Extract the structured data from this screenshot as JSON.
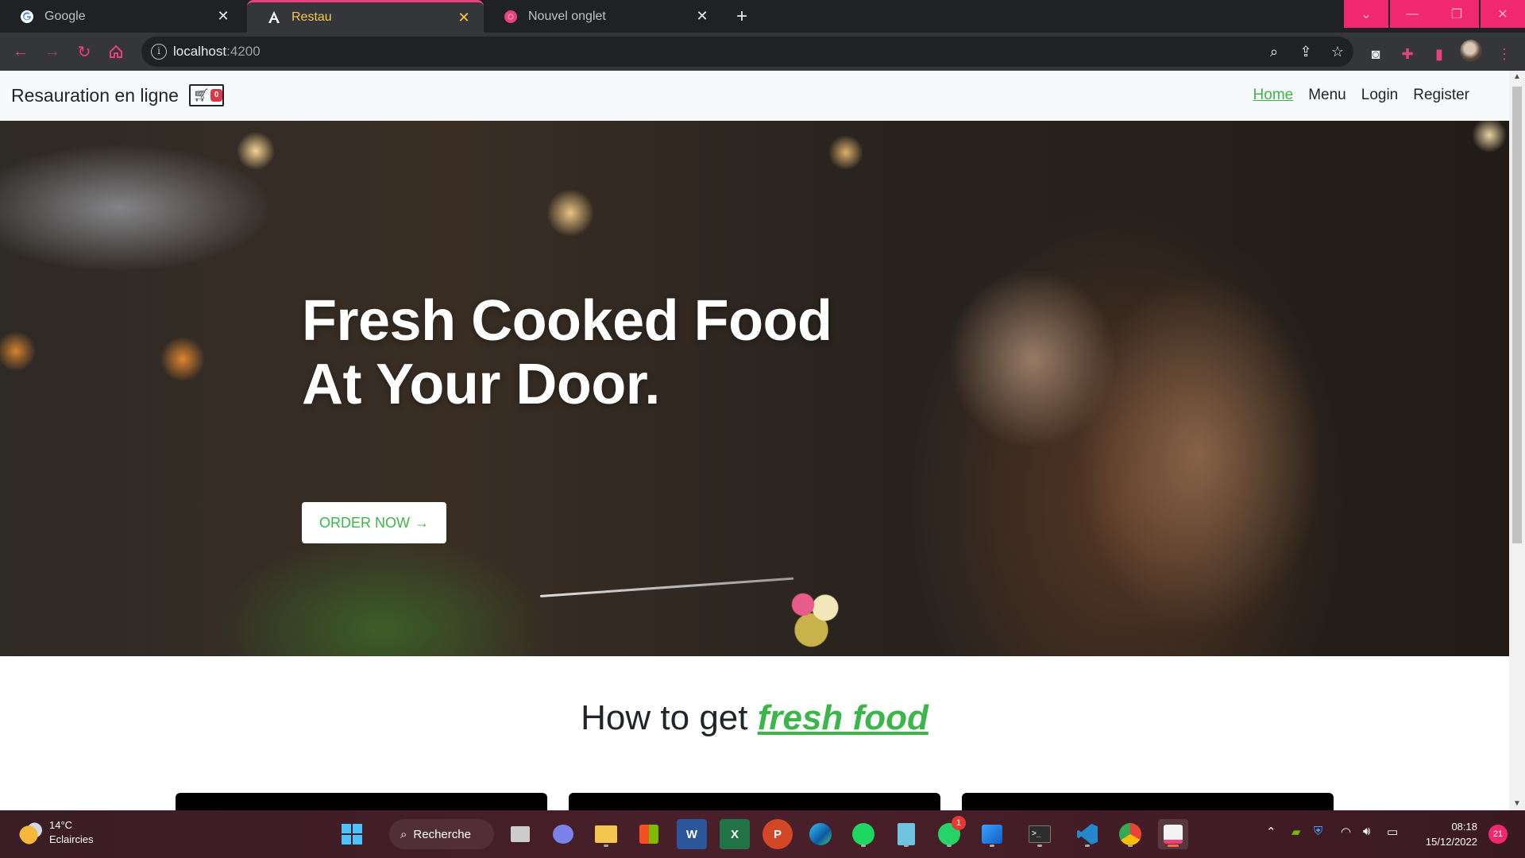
{
  "browser": {
    "tabs": [
      {
        "title": "Google",
        "favicon": "google-icon"
      },
      {
        "title": "Restau",
        "favicon": "angular-icon"
      },
      {
        "title": "Nouvel onglet",
        "favicon": "chrome-icon"
      }
    ],
    "url": {
      "host": "localhost",
      "port": ":4200"
    }
  },
  "page": {
    "brand": "Resauration en ligne",
    "cart_count": "0",
    "nav": [
      "Home",
      "Menu",
      "Login",
      "Register"
    ],
    "hero": {
      "line1": "Fresh Cooked Food",
      "line2": "At Your Door.",
      "cta": "ORDER NOW",
      "cta_arrow": "→"
    },
    "howto": {
      "prefix": "How to get ",
      "emphasis": "fresh food"
    }
  },
  "taskbar": {
    "weather": {
      "temp": "14°C",
      "desc": "Eclaircies"
    },
    "search_label": "Recherche",
    "whatsapp_badge": "1",
    "time": "08:18",
    "date": "15/12/2022",
    "notifications": "21"
  },
  "colors": {
    "accent": "#3cb54a",
    "chrome_accent": "#e8417b",
    "window_controls": "#f0286d"
  }
}
